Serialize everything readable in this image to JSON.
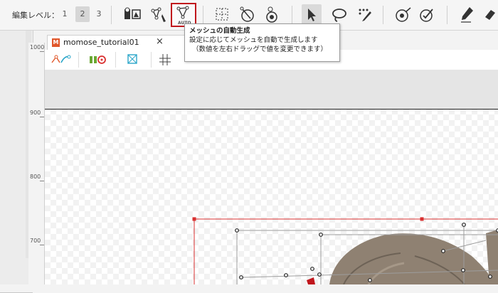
{
  "toolbar": {
    "edit_level_label": "編集レベル：",
    "levels": [
      "1",
      "2",
      "3"
    ],
    "active_level": "2",
    "auto_label": "AUTO"
  },
  "tooltip": {
    "title": "メッシュの自動生成",
    "line1": "設定に応じてメッシュを自動で生成します",
    "line2": "（数値を左右ドラッグで値を変更できます）"
  },
  "document": {
    "tab_name": "momose_tutorial01",
    "close_glyph": "×",
    "logo_letter": "M"
  },
  "ruler": {
    "labels": [
      "1000",
      "900",
      "800",
      "700"
    ]
  },
  "colors": {
    "highlight": "#c0161c",
    "mesh_red": "#d93030",
    "hair": "#8f8172"
  }
}
